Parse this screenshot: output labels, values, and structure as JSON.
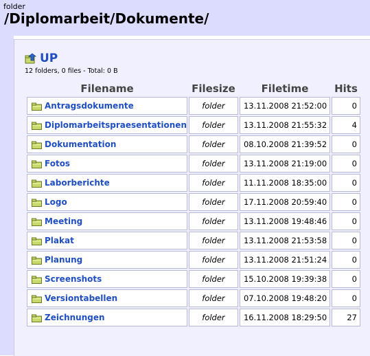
{
  "header": {
    "label": "folder",
    "path": "/Diplomarbeit/Dokumente/"
  },
  "nav": {
    "up_label": "UP"
  },
  "summary": "12 folders, 0 files - Total: 0 B",
  "columns": [
    "Filename",
    "Filesize",
    "Filetime",
    "Hits"
  ],
  "rows": [
    {
      "name": "Antragsdokumente",
      "size": "folder",
      "time": "13.11.2008 21:52:00",
      "hits": "0"
    },
    {
      "name": "Diplomarbeitspraesentationen",
      "size": "folder",
      "time": "13.11.2008 21:55:32",
      "hits": "4"
    },
    {
      "name": "Dokumentation",
      "size": "folder",
      "time": "08.10.2008 21:39:52",
      "hits": "0"
    },
    {
      "name": "Fotos",
      "size": "folder",
      "time": "13.11.2008 21:19:00",
      "hits": "0"
    },
    {
      "name": "Laborberichte",
      "size": "folder",
      "time": "11.11.2008 18:35:00",
      "hits": "0"
    },
    {
      "name": "Logo",
      "size": "folder",
      "time": "17.11.2008 20:59:40",
      "hits": "0"
    },
    {
      "name": "Meeting",
      "size": "folder",
      "time": "13.11.2008 19:48:46",
      "hits": "0"
    },
    {
      "name": "Plakat",
      "size": "folder",
      "time": "13.11.2008 21:53:58",
      "hits": "0"
    },
    {
      "name": "Planung",
      "size": "folder",
      "time": "13.11.2008 21:51:24",
      "hits": "0"
    },
    {
      "name": "Screenshots",
      "size": "folder",
      "time": "15.10.2008 19:39:38",
      "hits": "0"
    },
    {
      "name": "Versiontabellen",
      "size": "folder",
      "time": "07.10.2008 19:48:20",
      "hits": "0"
    },
    {
      "name": "Zeichnungen",
      "size": "folder",
      "time": "16.11.2008 18:29:50",
      "hits": "27"
    }
  ],
  "icons": {
    "up": "up-arrow-folder-icon",
    "row": "folder-icon"
  },
  "colors": {
    "header_bg": "#dcdcff",
    "panel_bg": "#f0f0ff",
    "link": "#1f4fc0"
  }
}
